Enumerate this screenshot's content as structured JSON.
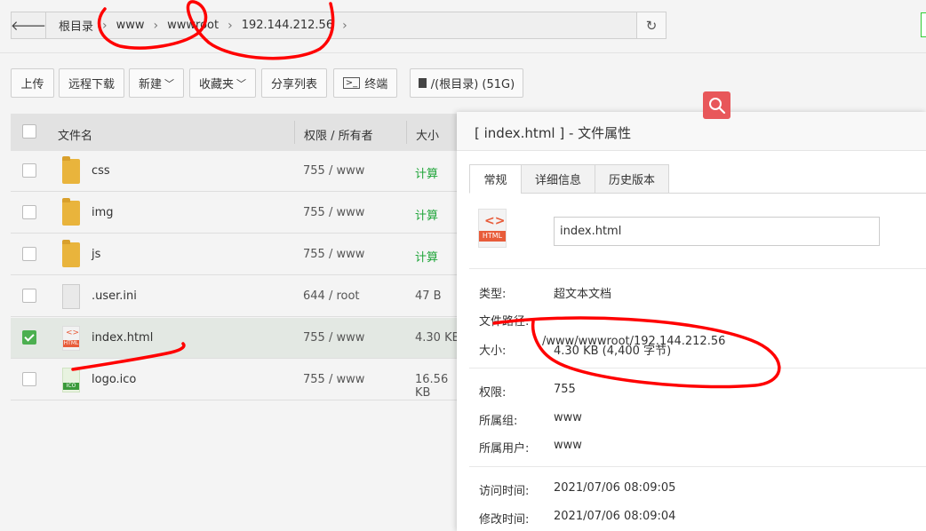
{
  "breadcrumb": {
    "back_icon": "arrow-left-icon",
    "items": [
      "根目录",
      "www",
      "wwwroot",
      "192.144.212.56"
    ],
    "refresh_icon": "refresh-icon"
  },
  "toolbar": {
    "upload": "上传",
    "remote_download": "远程下载",
    "new": "新建",
    "favorites": "收藏夹",
    "share_list": "分享列表",
    "terminal": "终端",
    "disk": "/(根目录) (51G)"
  },
  "table": {
    "headers": {
      "name": "文件名",
      "perm": "权限 / 所有者",
      "size": "大小"
    },
    "rows": [
      {
        "name": "css",
        "perm": "755 / www",
        "size": "计算",
        "icon": "folder-icon",
        "checked": false
      },
      {
        "name": "img",
        "perm": "755 / www",
        "size": "计算",
        "icon": "folder-icon",
        "checked": false
      },
      {
        "name": "js",
        "perm": "755 / www",
        "size": "计算",
        "icon": "folder-icon",
        "checked": false
      },
      {
        "name": ".user.ini",
        "perm": "644 / root",
        "size": "47 B",
        "icon": "file-icon",
        "checked": false
      },
      {
        "name": "index.html",
        "perm": "755 / www",
        "size": "4.30 KB",
        "icon": "html-file-icon",
        "checked": true
      },
      {
        "name": "logo.ico",
        "perm": "755 / www",
        "size": "16.56 KB",
        "icon": "ico-file-icon",
        "checked": false
      }
    ]
  },
  "panel": {
    "title": "[ index.html ] - 文件属性",
    "tabs": [
      "常规",
      "详细信息",
      "历史版本"
    ],
    "filename_value": "index.html",
    "icon_label": "HTML",
    "props": {
      "type_label": "类型:",
      "type_value": "超文本文档",
      "path_label": "文件路径:",
      "path_value": "/www/wwwroot/192.144.212.56",
      "size_label": "大小:",
      "size_value": "4.30 KB (4,400 字节)",
      "perm_label": "权限:",
      "perm_value": "755",
      "group_label": "所属组:",
      "group_value": "www",
      "user_label": "所属用户:",
      "user_value": "www",
      "atime_label": "访问时间:",
      "atime_value": "2021/07/06 08:09:05",
      "mtime_label": "修改时间:",
      "mtime_value": "2021/07/06 08:09:04"
    }
  },
  "colors": {
    "accent_green": "#20a53a",
    "search_red": "#e8575a",
    "annotation_red": "#ff0000"
  }
}
